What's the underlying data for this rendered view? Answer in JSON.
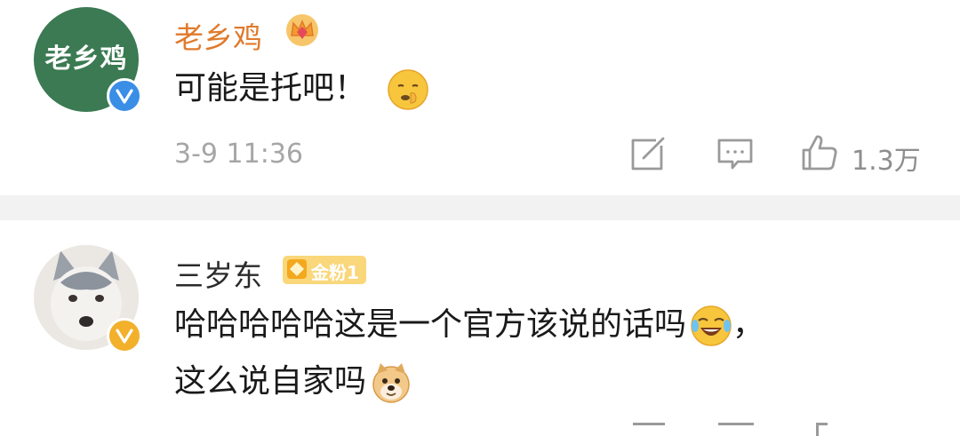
{
  "comments": [
    {
      "avatar_text": "老乡鸡",
      "username": "老乡鸡",
      "user_badge": "crown-icon",
      "verified": "blue-v",
      "text": "可能是托吧！",
      "emoji": "shush-face",
      "time": "3-9 11:36",
      "likes": "1.3万"
    },
    {
      "username": "三岁东",
      "fan_badge": "金粉1",
      "verified": "gold-v",
      "text_line1": "哈哈哈哈哈这是一个官方该说的话吗",
      "text_punct": "，",
      "text_line2": "这么说自家吗",
      "emoji1": "laughing-crying-face",
      "emoji2": "doge-face"
    }
  ],
  "colors": {
    "brand_green": "#3b7a52",
    "username_orange": "#e07a2c",
    "verified_blue": "#3a8ee6",
    "verified_gold": "#f2b02b",
    "meta_gray": "#a6a6a6",
    "divider": "#f2f2f2"
  }
}
